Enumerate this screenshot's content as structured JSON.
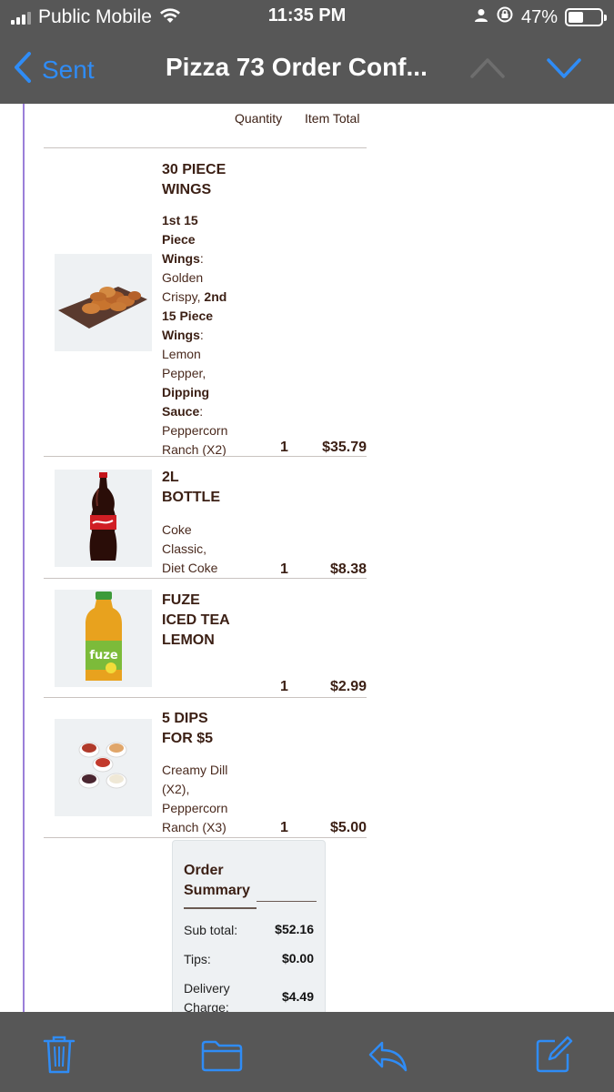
{
  "status_bar": {
    "carrier": "Public Mobile",
    "time": "11:35 PM",
    "battery": "47%"
  },
  "nav": {
    "back_label": "Sent",
    "title": "Pizza 73 Order Conf..."
  },
  "columns": {
    "quantity": "Quantity",
    "item_total": "Item Total"
  },
  "items": [
    {
      "name_lines": [
        "30 PIECE",
        "WINGS"
      ],
      "quantity": "1",
      "total": "$35.79",
      "image": "wings-image"
    },
    {
      "name_lines": [
        "2L",
        "BOTTLE"
      ],
      "desc_lines": [
        "Coke",
        "Classic,",
        "Diet Coke"
      ],
      "quantity": "1",
      "total": "$8.38",
      "image": "coke-bottle-image"
    },
    {
      "name_lines": [
        "FUZE",
        "ICED TEA",
        "LEMON"
      ],
      "quantity": "1",
      "total": "$2.99",
      "image": "fuze-bottle-image"
    },
    {
      "name_lines": [
        "5 DIPS",
        "FOR $5"
      ],
      "desc_lines": [
        "Creamy Dill",
        "(X2),",
        "Peppercorn",
        "Ranch (X3)"
      ],
      "quantity": "1",
      "total": "$5.00",
      "image": "dips-image"
    }
  ],
  "wings_desc": {
    "l1": "1st 15",
    "l2": "Piece",
    "l3b": "Wings",
    "l3c": ":",
    "l4": "Golden",
    "l5a": "Crispy, ",
    "l5b": "2nd",
    "l6": "15 Piece",
    "l7b": "Wings",
    "l7c": ":",
    "l8": "Lemon",
    "l9": "Pepper,",
    "l10": "Dipping",
    "l11b": "Sauce",
    "l11c": ":",
    "l12": "Peppercorn",
    "l13": "Ranch (X2)"
  },
  "summary": {
    "title_lines": [
      "Order",
      "Summary"
    ],
    "rows": [
      {
        "label": "Sub total:",
        "value": "$52.16"
      },
      {
        "label": "Tips:",
        "value": "$0.00"
      },
      {
        "label_lines": [
          "Delivery",
          "Charge:"
        ],
        "value": "$4.49"
      }
    ]
  },
  "toolbar": {
    "icons": [
      "trash-icon",
      "folder-icon",
      "reply-icon",
      "compose-icon"
    ]
  },
  "colors": {
    "accent": "#2f8cf6",
    "bar_bg": "#575757",
    "text_brown": "#3b1f14"
  }
}
